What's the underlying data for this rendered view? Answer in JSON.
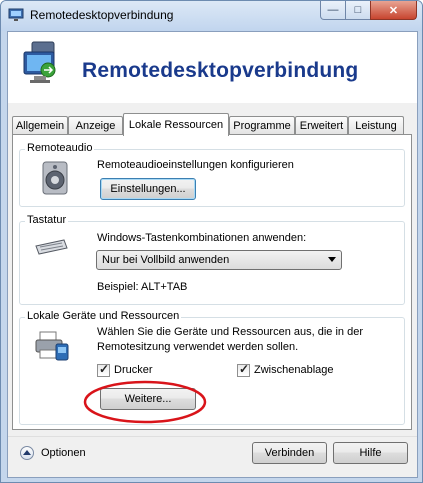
{
  "window": {
    "title": "Remotedesktopverbindung",
    "minimize_glyph": "—",
    "maximize_glyph": "□",
    "close_glyph": "✕"
  },
  "banner": {
    "title": "Remotedesktopverbindung"
  },
  "tabs": [
    {
      "label": "Allgemein",
      "active": false
    },
    {
      "label": "Anzeige",
      "active": false
    },
    {
      "label": "Lokale Ressourcen",
      "active": true
    },
    {
      "label": "Programme",
      "active": false
    },
    {
      "label": "Erweitert",
      "active": false
    },
    {
      "label": "Leistung",
      "active": false
    }
  ],
  "remoteaudio": {
    "group_label": "Remoteaudio",
    "description": "Remoteaudioeinstellungen konfigurieren",
    "settings_button": "Einstellungen..."
  },
  "tastatur": {
    "group_label": "Tastatur",
    "description": "Windows-Tastenkombinationen anwenden:",
    "selected_option": "Nur bei Vollbild anwenden",
    "example": "Beispiel: ALT+TAB"
  },
  "lokale_geraete": {
    "group_label": "Lokale Geräte und Ressourcen",
    "description_line1": "Wählen Sie die Geräte und Ressourcen aus, die in der",
    "description_line2": "Remotesitzung verwendet werden sollen.",
    "printer_label": "Drucker",
    "printer_checked": true,
    "clipboard_label": "Zwischenablage",
    "clipboard_checked": true,
    "more_button": "Weitere..."
  },
  "footer": {
    "options_label": "Optionen",
    "connect_button": "Verbinden",
    "help_button": "Hilfe"
  },
  "colors": {
    "banner_title": "#1a3a8c",
    "annotation_ellipse": "#d9141a"
  },
  "icons": {
    "title": "remote-desktop-icon",
    "banner": "remote-desktop-large-icon",
    "audio": "speaker-icon",
    "keyboard": "keyboard-icon",
    "devices": "printer-devices-icon",
    "options": "chevron-up-icon"
  }
}
